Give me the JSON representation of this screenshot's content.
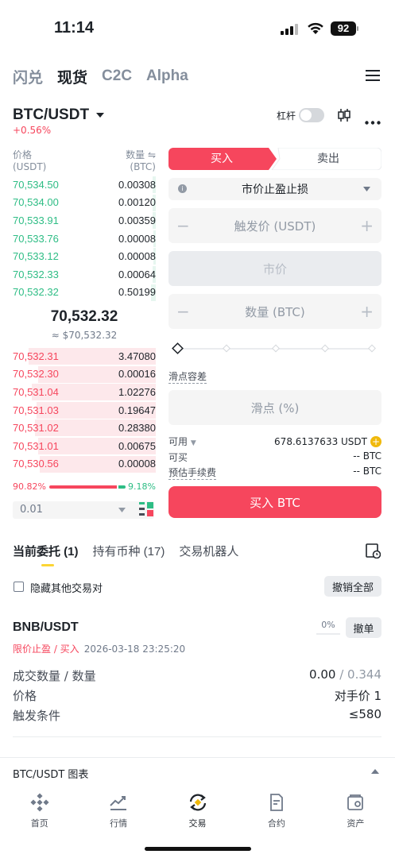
{
  "status_bar": {
    "time": "11:14",
    "battery": "92"
  },
  "top_tabs": [
    {
      "label": "闪兑",
      "active": false
    },
    {
      "label": "现货",
      "active": true
    },
    {
      "label": "C2C",
      "active": false
    },
    {
      "label": "Alpha",
      "active": false
    }
  ],
  "pair": {
    "symbol": "BTC/USDT",
    "change": "+0.56%",
    "leverage_label": "杠杆"
  },
  "orderbook": {
    "price_header": "价格",
    "price_unit": "(USDT)",
    "qty_header": "数量",
    "qty_unit": "(BTC)",
    "bids_top": [
      {
        "price": "70,534.50",
        "qty": "0.00308"
      },
      {
        "price": "70,534.00",
        "qty": "0.00120"
      },
      {
        "price": "70,533.91",
        "qty": "0.00359"
      },
      {
        "price": "70,533.76",
        "qty": "0.00008"
      },
      {
        "price": "70,533.12",
        "qty": "0.00008"
      },
      {
        "price": "70,532.33",
        "qty": "0.00064"
      },
      {
        "price": "70,532.32",
        "qty": "0.50199"
      }
    ],
    "mid_price": "70,532.32",
    "mid_price_usd": "≈ $70,532.32",
    "asks_bottom": [
      {
        "price": "70,532.31",
        "qty": "3.47080"
      },
      {
        "price": "70,532.30",
        "qty": "0.00016"
      },
      {
        "price": "70,531.04",
        "qty": "1.02276"
      },
      {
        "price": "70,531.03",
        "qty": "0.19647"
      },
      {
        "price": "70,531.02",
        "qty": "0.28380"
      },
      {
        "price": "70,531.01",
        "qty": "0.00675"
      },
      {
        "price": "70,530.56",
        "qty": "0.00008"
      }
    ],
    "buy_ratio": "90.82%",
    "sell_ratio": "9.18%",
    "buy_ratio_value": 0.9082,
    "step": "0.01"
  },
  "trade_form": {
    "buy_tab": "买入",
    "sell_tab": "卖出",
    "order_type": "市价止盈止损",
    "trigger_placeholder": "触发价 (USDT)",
    "market_label": "市价",
    "qty_placeholder": "数量 (BTC)",
    "slippage_tolerance_label": "滑点容差",
    "slippage_placeholder": "滑点 (%)",
    "available_label": "可用",
    "available_value": "678.6137633 USDT",
    "can_buy_label": "可买",
    "can_buy_value": "-- BTC",
    "est_fee_label": "预估手续费",
    "est_fee_value": "-- BTC",
    "submit_label": "买入 BTC"
  },
  "orders": {
    "tabs": [
      {
        "label": "当前委托 (1)",
        "active": true
      },
      {
        "label": "持有币种 (17)",
        "active": false
      },
      {
        "label": "交易机器人",
        "active": false
      }
    ],
    "hide_others_label": "隐藏其他交易对",
    "cancel_all_label": "撤销全部",
    "items": [
      {
        "symbol": "BNB/USDT",
        "type": "限价止盈 / 买入",
        "time": "2026-03-18 23:25:20",
        "fill_percent": "0%",
        "cancel_label": "撤单",
        "filled_label": "成交数量 / 数量",
        "filled_done": "0.00",
        "filled_total": " / 0.344",
        "price_label": "价格",
        "price_value": "对手价 1",
        "trigger_label": "触发条件",
        "trigger_value": "≤580"
      }
    ]
  },
  "chart_bar": {
    "label": "BTC/USDT 图表"
  },
  "bottom_nav": [
    {
      "label": "首页",
      "icon": "home-diamond-icon"
    },
    {
      "label": "行情",
      "icon": "market-chart-icon"
    },
    {
      "label": "交易",
      "icon": "trade-swap-icon"
    },
    {
      "label": "合约",
      "icon": "futures-doc-icon"
    },
    {
      "label": "资产",
      "icon": "wallet-icon"
    }
  ],
  "colors": {
    "green": "#2ebd85",
    "red": "#f6465d",
    "accent": "#fcd535",
    "gold": "#f0b90b"
  }
}
